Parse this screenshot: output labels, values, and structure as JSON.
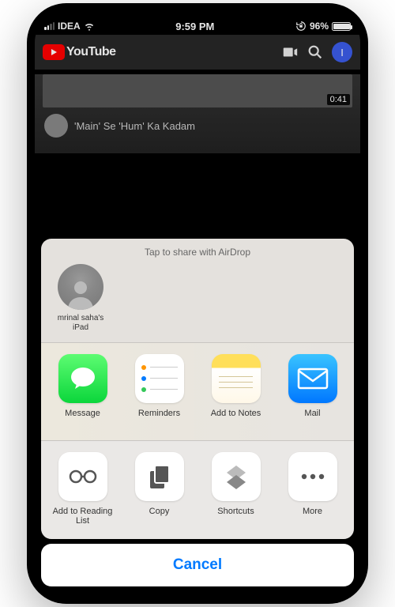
{
  "status": {
    "carrier": "IDEA",
    "time": "9:59 PM",
    "battery_pct": "96%"
  },
  "youtube": {
    "brand": "YouTube",
    "avatar_initial": "I",
    "video_duration": "0:41",
    "video_title": "'Main' Se 'Hum' Ka Kadam"
  },
  "share": {
    "airdrop_hint": "Tap to share with AirDrop",
    "airdrop_targets": [
      {
        "name": "mrinal saha's iPad"
      }
    ],
    "apps": [
      {
        "label": "Message"
      },
      {
        "label": "Reminders"
      },
      {
        "label": "Add to Notes"
      },
      {
        "label": "Mail"
      }
    ],
    "actions": [
      {
        "label": "Add to Reading List"
      },
      {
        "label": "Copy"
      },
      {
        "label": "Shortcuts"
      },
      {
        "label": "More"
      }
    ],
    "cancel": "Cancel"
  }
}
